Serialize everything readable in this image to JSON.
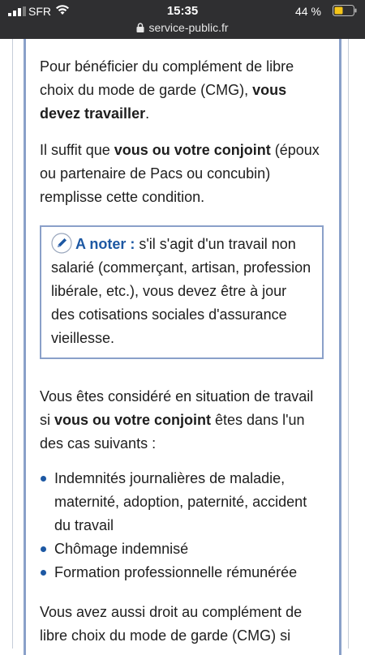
{
  "status_bar": {
    "carrier": "SFR",
    "time": "15:35",
    "battery": "44 %"
  },
  "browser": {
    "url": "service-public.fr"
  },
  "content": {
    "p1_a": "Pour bénéficier du complément de libre choix du mode de garde (CMG), ",
    "p1_b": "vous devez travailler",
    "p1_c": ".",
    "p2_a": "Il suffit que ",
    "p2_b": "vous ou votre conjoint",
    "p2_c": " (époux ou partenaire de Pacs ou concubin) remplisse cette condition.",
    "note_label": "A noter :",
    "note_text": " s'il s'agit d'un travail non salarié (commerçant, artisan, profession libérale, etc.), vous devez être à jour des cotisations sociales d'assurance vieillesse.",
    "p3_a": "Vous êtes considéré en situation de travail si ",
    "p3_b": "vous ou votre conjoint",
    "p3_c": " êtes dans l'un des cas suivants :",
    "list": [
      "Indemnités journalières de maladie, maternité, adoption, paternité, accident du travail",
      "Chômage indemnisé",
      "Formation professionnelle rémunérée"
    ],
    "p4_a": "Vous avez aussi droit au complément de libre choix du mode de garde (CMG) si"
  },
  "colors": {
    "header_bg": "#2f2f31",
    "accent": "#1d58a3",
    "box_border": "#8aa0c9",
    "battery": "#f5c518"
  }
}
